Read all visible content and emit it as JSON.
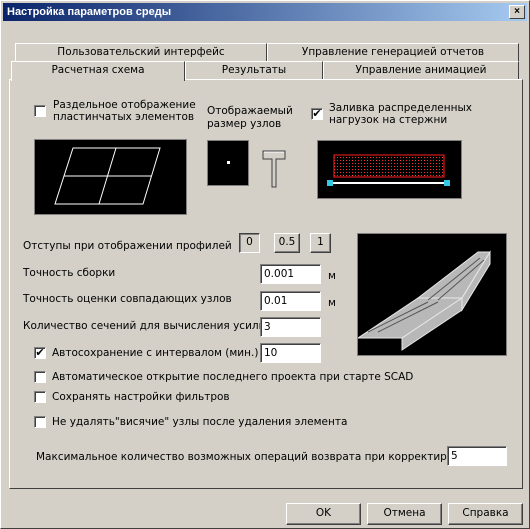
{
  "window": {
    "title": "Настройка параметров среды",
    "close": "×"
  },
  "tabs_row1": [
    {
      "label": "Пользовательский интерфейс"
    },
    {
      "label": "Управление генерацией отчетов"
    }
  ],
  "tabs_row2": [
    {
      "label": "Расчетная схема",
      "active": true
    },
    {
      "label": "Результаты"
    },
    {
      "label": "Управление анимацией"
    }
  ],
  "scheme": {
    "separate_plates": {
      "label1": "Раздельное отображение",
      "label2": "пластинчатых элементов",
      "checked": false
    },
    "node_size": {
      "label1": "Отображаемый",
      "label2": "размер узлов"
    },
    "fill_loads": {
      "label1": "Заливка распределенных",
      "label2": "нагрузок на стержни",
      "checked": true
    }
  },
  "profile_offsets": {
    "label": "Отступы при отображении профилей",
    "options": [
      "0",
      "0.5",
      "1"
    ]
  },
  "assembly_precision": {
    "label": "Точность сборки",
    "value": "0.001",
    "unit": "м"
  },
  "node_precision": {
    "label": "Точность оценки совпадающих узлов",
    "value": "0.01",
    "unit": "м"
  },
  "sections_count": {
    "label": "Количество сечений для вычисления усилий",
    "value": "3"
  },
  "autosave": {
    "label": "Автосохранение с интервалом (мин.)",
    "value": "10",
    "checked": true
  },
  "auto_open": {
    "label": "Автоматическое открытие последнего проекта при старте SCAD",
    "checked": false
  },
  "save_filters": {
    "label": "Сохранять настройки фильтров",
    "checked": false
  },
  "keep_nodes": {
    "label": "Не удалять\"висячие\" узлы после удаления элемента",
    "checked": false
  },
  "undo_ops": {
    "label": "Максимальное количество возможных операций возврата при корректировке",
    "value": "5"
  },
  "buttons": {
    "ok": "OK",
    "cancel": "Отмена",
    "help": "Справка"
  }
}
